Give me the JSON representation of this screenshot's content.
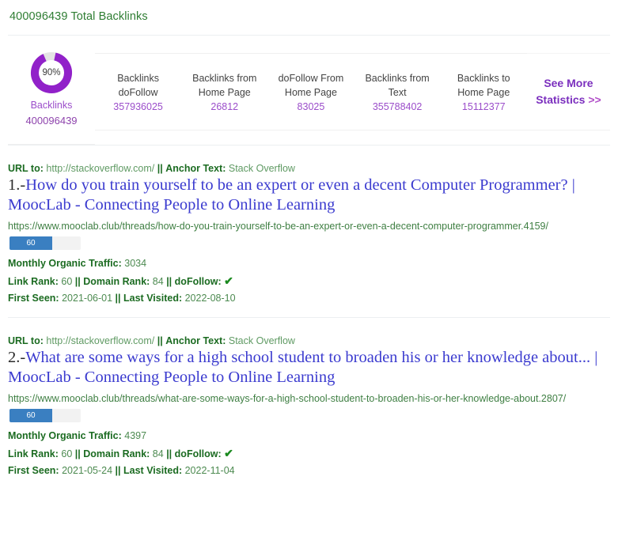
{
  "header": {
    "total_backlinks_text": "400096439 Total Backlinks"
  },
  "stats": {
    "donut": {
      "percent_label": "90%",
      "percent_value": 90,
      "title": "Backlinks",
      "value": "400096439",
      "ring_color": "#9121c9",
      "track_color": "#e4e4e4"
    },
    "cards": [
      {
        "label_line1": "Backlinks",
        "label_line2": "doFollow",
        "value": "357936025"
      },
      {
        "label_line1": "Backlinks from",
        "label_line2": "Home Page",
        "value": "26812"
      },
      {
        "label_line1": "doFollow From",
        "label_line2": "Home Page",
        "value": "83025"
      },
      {
        "label_line1": "Backlinks from",
        "label_line2": "Text",
        "value": "355788402"
      },
      {
        "label_line1": "Backlinks to",
        "label_line2": "Home Page",
        "value": "15112377"
      }
    ],
    "see_more": {
      "line1": "See More",
      "line2": "Statistics",
      "chevron": ">>"
    }
  },
  "results": [
    {
      "url_to_label": "URL to:",
      "url_to_value": "http://stackoverflow.com/",
      "anchor_label": "Anchor Text:",
      "anchor_value": "Stack Overflow",
      "divider_pipes": "||",
      "number": "1.-",
      "title": "How do you train yourself to be an expert or even a decent Computer Programmer? | MoocLab - Connecting People to Online Learning",
      "url": "https://www.mooclab.club/threads/how-do-you-train-yourself-to-be-an-expert-or-even-a-decent-computer-programmer.4159/",
      "progress_value": "60",
      "progress_percent": 60,
      "traffic_label": "Monthly Organic Traffic:",
      "traffic_value": "3034",
      "link_rank_label": "Link Rank:",
      "link_rank_value": "60",
      "domain_rank_label": "Domain Rank:",
      "domain_rank_value": "84",
      "dofollow_label": "doFollow:",
      "dofollow_icon": "check-icon",
      "first_seen_label": "First Seen:",
      "first_seen_value": "2021-06-01",
      "last_visited_label": "Last Visited:",
      "last_visited_value": "2022-08-10"
    },
    {
      "url_to_label": "URL to:",
      "url_to_value": "http://stackoverflow.com/",
      "anchor_label": "Anchor Text:",
      "anchor_value": "Stack Overflow",
      "divider_pipes": "||",
      "number": "2.-",
      "title": "What are some ways for a high school student to broaden his or her knowledge about... | MoocLab - Connecting People to Online Learning",
      "url": "https://www.mooclab.club/threads/what-are-some-ways-for-a-high-school-student-to-broaden-his-or-her-knowledge-about.2807/",
      "progress_value": "60",
      "progress_percent": 60,
      "traffic_label": "Monthly Organic Traffic:",
      "traffic_value": "4397",
      "link_rank_label": "Link Rank:",
      "link_rank_value": "60",
      "domain_rank_label": "Domain Rank:",
      "domain_rank_value": "84",
      "dofollow_label": "doFollow:",
      "dofollow_icon": "check-icon",
      "first_seen_label": "First Seen:",
      "first_seen_value": "2021-05-24",
      "last_visited_label": "Last Visited:",
      "last_visited_value": "2022-11-04"
    }
  ]
}
